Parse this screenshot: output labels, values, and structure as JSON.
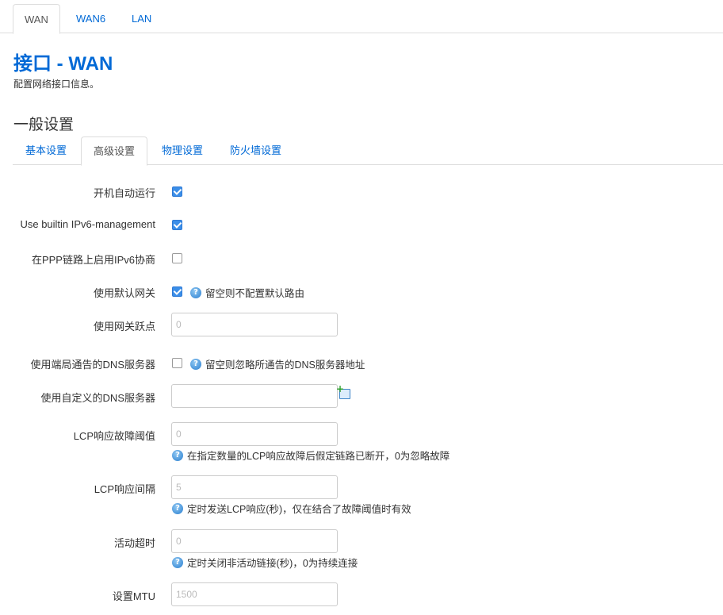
{
  "top_tabs": [
    "WAN",
    "WAN6",
    "LAN"
  ],
  "page_title": "接口 - WAN",
  "page_desc": "配置网络接口信息。",
  "section_title": "一般设置",
  "sub_tabs": [
    "基本设置",
    "高级设置",
    "物理设置",
    "防火墙设置"
  ],
  "fields": {
    "autostart": {
      "label": "开机自动运行",
      "checked": true
    },
    "ipv6_builtin": {
      "label": "Use builtin IPv6-management",
      "checked": true
    },
    "ppp_ipv6": {
      "label": "在PPP链路上启用IPv6协商",
      "checked": false
    },
    "default_gw": {
      "label": "使用默认网关",
      "checked": true,
      "help": "留空则不配置默认路由"
    },
    "gw_metric": {
      "label": "使用网关跃点",
      "placeholder": "0"
    },
    "peer_dns": {
      "label": "使用端局通告的DNS服务器",
      "checked": false,
      "help": "留空则忽略所通告的DNS服务器地址"
    },
    "custom_dns": {
      "label": "使用自定义的DNS服务器",
      "placeholder": ""
    },
    "lcp_failure": {
      "label": "LCP响应故障阈值",
      "placeholder": "0",
      "help": "在指定数量的LCP响应故障后假定链路已断开，0为忽略故障"
    },
    "lcp_interval": {
      "label": "LCP响应间隔",
      "placeholder": "5",
      "help": "定时发送LCP响应(秒)，仅在结合了故障阈值时有效"
    },
    "idle_timeout": {
      "label": "活动超时",
      "placeholder": "0",
      "help": "定时关闭非活动链接(秒)，0为持续连接"
    },
    "mtu": {
      "label": "设置MTU",
      "placeholder": "1500"
    }
  },
  "icons": {
    "help": "help-icon",
    "add": "add-icon"
  }
}
